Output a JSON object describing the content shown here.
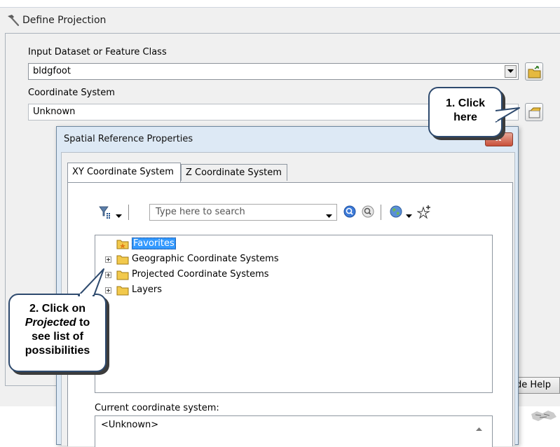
{
  "main_window": {
    "title": "Define Projection",
    "input_label": "Input Dataset or Feature Class",
    "input_value": "bldgfoot",
    "coord_label": "Coordinate System",
    "coord_value": "Unknown",
    "help_button": "Tool Help",
    "help_button_visible": "de Help"
  },
  "dialog": {
    "title": "Spatial Reference Properties",
    "close_glyph": "x",
    "tabs": [
      {
        "label": "XY Coordinate System",
        "active": true
      },
      {
        "label": "Z Coordinate System",
        "active": false
      }
    ],
    "search_placeholder": "Type here to search",
    "tree": [
      {
        "label": "Favorites",
        "icon": "favorites-folder-icon",
        "expander": false,
        "selected": true
      },
      {
        "label": "Geographic Coordinate Systems",
        "icon": "folder-icon",
        "expander": true,
        "selected": false
      },
      {
        "label": "Projected Coordinate Systems",
        "icon": "folder-icon",
        "expander": true,
        "selected": false
      },
      {
        "label": "Layers",
        "icon": "folder-icon",
        "expander": true,
        "selected": false
      }
    ],
    "current_label": "Current coordinate system:",
    "current_value": "<Unknown>"
  },
  "callouts": {
    "one_line1": "1. Click",
    "one_line2": "here",
    "two_line1": "2. Click on",
    "two_line2": "Projected",
    "two_line2_suffix": " to",
    "two_line3": "see list of",
    "two_line4": "possibilities"
  },
  "colors": {
    "accent_selection": "#3399ff",
    "callout_border": "#2e4a6e",
    "dialog_frame": "#dde9f5",
    "close_button": "#c9503a"
  }
}
